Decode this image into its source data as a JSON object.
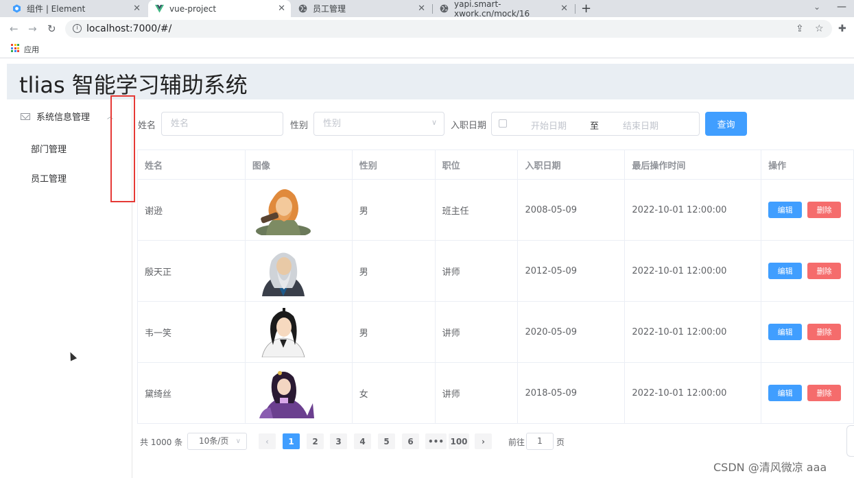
{
  "browser": {
    "tabs": [
      {
        "label": "组件 | Element",
        "icon": "element-logo-icon"
      },
      {
        "label": "vue-project",
        "icon": "vue-logo-icon"
      },
      {
        "label": "员工管理",
        "icon": "globe-icon"
      },
      {
        "label": "yapi.smart-xwork.cn/mock/16",
        "icon": "globe-icon"
      }
    ],
    "new_tab": "+",
    "url": "localhost:7000/#/",
    "bookmark_label": "应用"
  },
  "app": {
    "title": "tlias 智能学习辅助系统",
    "menu": {
      "group_label": "系统信息管理",
      "items": [
        "部门管理",
        "员工管理"
      ]
    },
    "search": {
      "name_label": "姓名",
      "name_placeholder": "姓名",
      "gender_label": "性别",
      "gender_placeholder": "性别",
      "date_label": "入职日期",
      "date_start_placeholder": "开始日期",
      "date_separator": "至",
      "date_end_placeholder": "结束日期",
      "query_button": "查询"
    },
    "table": {
      "headers": [
        "姓名",
        "图像",
        "性别",
        "职位",
        "入职日期",
        "最后操作时间",
        "操作"
      ],
      "rows": [
        {
          "name": "谢逊",
          "gender": "男",
          "position": "班主任",
          "entry_date": "2008-05-09",
          "updated": "2022-10-01 12:00:00"
        },
        {
          "name": "殷天正",
          "gender": "男",
          "position": "讲师",
          "entry_date": "2012-05-09",
          "updated": "2022-10-01 12:00:00"
        },
        {
          "name": "韦一笑",
          "gender": "男",
          "position": "讲师",
          "entry_date": "2020-05-09",
          "updated": "2022-10-01 12:00:00"
        },
        {
          "name": "黛绮丝",
          "gender": "女",
          "position": "讲师",
          "entry_date": "2018-05-09",
          "updated": "2022-10-01 12:00:00"
        }
      ],
      "edit_label": "编辑",
      "delete_label": "删除"
    },
    "pagination": {
      "total_text": "共 1000 条",
      "page_size": "10条/页",
      "pages": [
        "1",
        "2",
        "3",
        "4",
        "5",
        "6",
        "•••",
        "100"
      ],
      "current_page": "1",
      "goto_label": "前往",
      "goto_value": "1",
      "goto_suffix": "页"
    }
  },
  "watermark": "CSDN @清风微凉 aaa",
  "colors": {
    "primary": "#409eff",
    "danger": "#f56c6c",
    "header_bg": "#e9eef3",
    "highlight_box": "#e53935"
  }
}
